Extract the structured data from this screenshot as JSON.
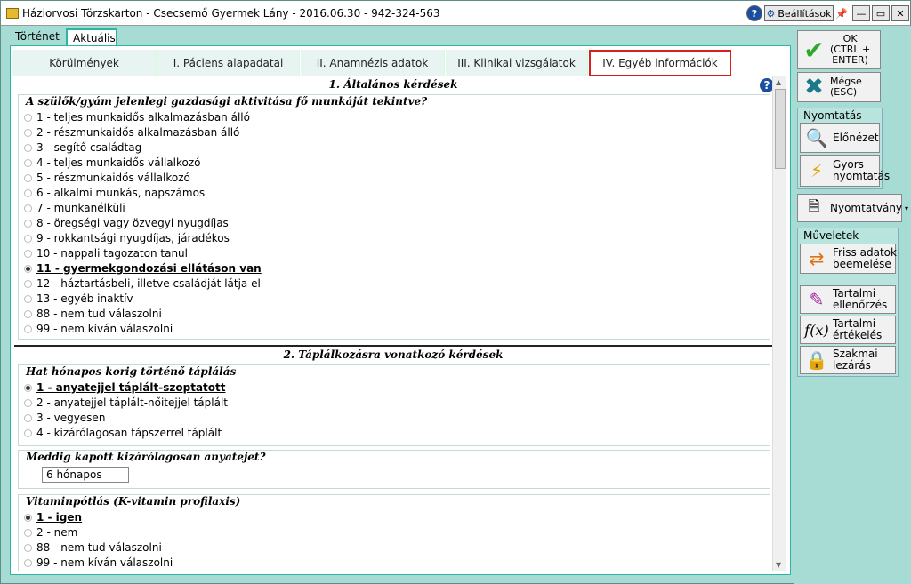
{
  "window": {
    "title": "Háziorvosi Törzskarton - Csecsemő Gyermek Lány - 2016.06.30 - 942-324-563",
    "settings_label": "Beállítások",
    "help": "?",
    "minimize": "—",
    "restore": "▭",
    "close": "✕"
  },
  "main_tabs": [
    {
      "label": "Történet"
    },
    {
      "label": "Aktuális"
    }
  ],
  "sub_tabs": [
    {
      "label": "Körülmények"
    },
    {
      "label": "I. Páciens alapadatai"
    },
    {
      "label": "II. Anamnézis adatok"
    },
    {
      "label": "III. Klinikai vizsgálatok"
    },
    {
      "label": "IV. Egyéb információk"
    }
  ],
  "section1": {
    "title": "1. Általános kérdések",
    "question": "A szülők/gyám jelenlegi gazdasági aktivitása fő munkáját tekintve?",
    "options": [
      {
        "label": "1 - teljes munkaidős alkalmazásban álló",
        "selected": false
      },
      {
        "label": "2 - részmunkaidős alkalmazásban álló",
        "selected": false
      },
      {
        "label": "3 - segítő családtag",
        "selected": false
      },
      {
        "label": "4 - teljes munkaidős vállalkozó",
        "selected": false
      },
      {
        "label": "5 - részmunkaidős vállalkozó",
        "selected": false
      },
      {
        "label": "6 - alkalmi munkás, napszámos",
        "selected": false
      },
      {
        "label": "7 - munkanélküli",
        "selected": false
      },
      {
        "label": "8 - öregségi vagy özvegyi nyugdíjas",
        "selected": false
      },
      {
        "label": "9 - rokkantsági nyugdíjas, járadékos",
        "selected": false
      },
      {
        "label": "10 - nappali tagozaton tanul",
        "selected": false
      },
      {
        "label": "11 - gyermekgondozási ellátáson van",
        "selected": true
      },
      {
        "label": "12 - háztartásbeli, illetve családját látja el",
        "selected": false
      },
      {
        "label": "13 - egyéb inaktív",
        "selected": false
      },
      {
        "label": "88 - nem tud válaszolni",
        "selected": false
      },
      {
        "label": "99 - nem kíván válaszolni",
        "selected": false
      }
    ]
  },
  "section2": {
    "title": "2. Táplálkozásra vonatkozó kérdések",
    "q1": {
      "question": "Hat hónapos korig történő táplálás",
      "options": [
        {
          "label": "1 - anyatejjel táplált-szoptatott",
          "selected": true
        },
        {
          "label": "2 - anyatejjel táplált-nőitejjel táplált",
          "selected": false
        },
        {
          "label": "3 - vegyesen",
          "selected": false
        },
        {
          "label": "4 - kizárólagosan tápszerrel táplált",
          "selected": false
        }
      ]
    },
    "q2": {
      "question": "Meddig kapott kizárólagosan anyatejet?",
      "value": "6 hónapos"
    },
    "q3": {
      "question": "Vitaminpótlás (K-vitamin profilaxis)",
      "options": [
        {
          "label": "1 - igen",
          "selected": true
        },
        {
          "label": "2 - nem",
          "selected": false
        },
        {
          "label": "88 - nem tud válaszolni",
          "selected": false
        },
        {
          "label": "99 - nem kíván válaszolni",
          "selected": false
        }
      ]
    }
  },
  "sidebar": {
    "ok_label": "OK\n(CTRL +\nENTER)",
    "cancel_label": "Mégse\n(ESC)",
    "print_group": "Nyomtatás",
    "preview_label": "Előnézet",
    "quick_print_label": "Gyors\nnyomtatás",
    "form_label": "Nyomtatvány",
    "ops_group": "Műveletek",
    "fresh_data_label": "Friss adatok\nbeemelése",
    "content_check_label": "Tartalmi\nellenőrzés",
    "content_eval_label": "Tartalmi\nértékelés",
    "lock_label": "Szakmai\nlezárás"
  },
  "colors": {
    "accent": "#2ab5a5",
    "selected_tab_border": "#d62020",
    "window_bg": "#a6dcd4"
  }
}
